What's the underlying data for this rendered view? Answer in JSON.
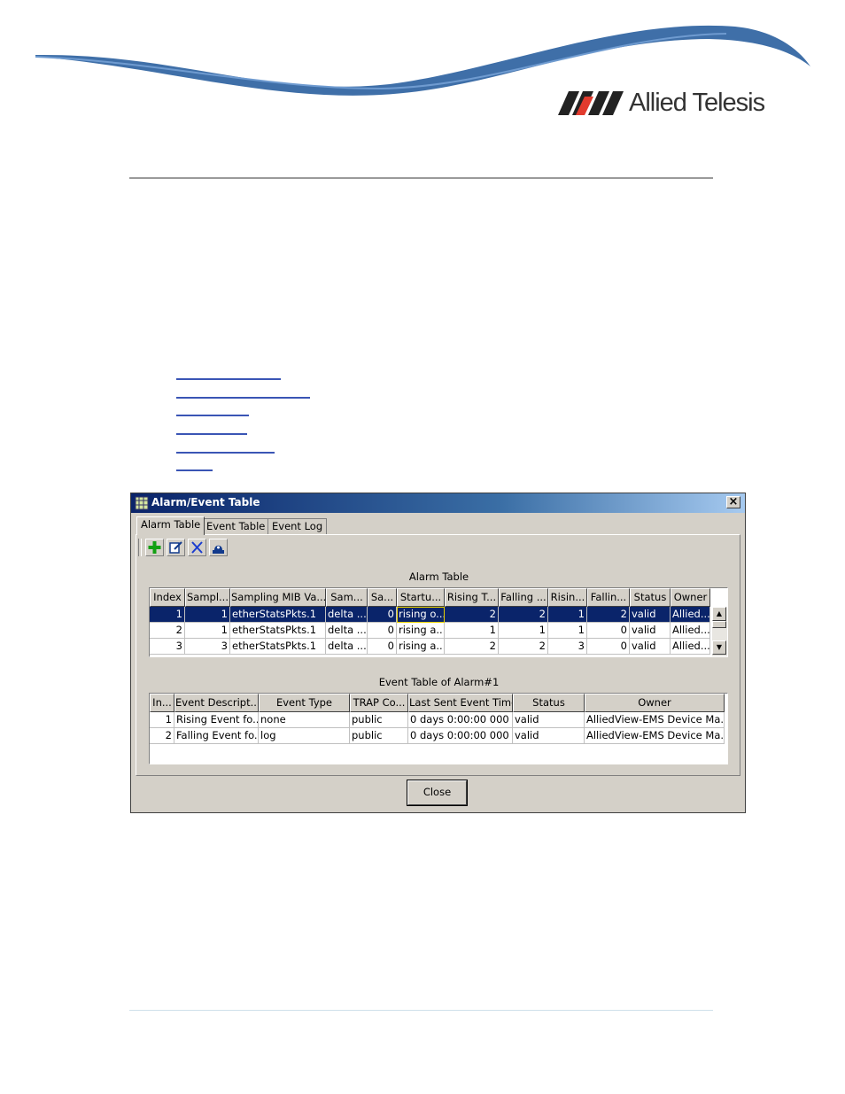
{
  "brand": {
    "name": "Allied Telesis"
  },
  "colors": {
    "link": "#3a55b5",
    "title_bar": "#0a246a",
    "selection": "#0a246a",
    "window_bg": "#d4d0c8"
  },
  "toc_links": 6,
  "dialog": {
    "title": "Alarm/Event Table",
    "tabs": [
      {
        "label": "Alarm Table",
        "active": true
      },
      {
        "label": "Event Table",
        "active": false
      },
      {
        "label": "Event Log",
        "active": false
      }
    ],
    "toolbar": [
      {
        "name": "add-icon"
      },
      {
        "name": "edit-icon"
      },
      {
        "name": "delete-icon"
      },
      {
        "name": "alarm-bell-icon"
      }
    ],
    "alarm_table": {
      "caption": "Alarm Table",
      "headers": [
        "Index",
        "Sampl...",
        "Sampling MIB Va...",
        "Sam...",
        "Sa...",
        "Startu...",
        "Rising T...",
        "Falling ...",
        "Risin...",
        "Fallin...",
        "Status",
        "Owner"
      ],
      "rows": [
        [
          "1",
          "1",
          "etherStatsPkts.1",
          "delta ...",
          "0",
          "rising o...",
          "2",
          "2",
          "1",
          "2",
          "valid",
          "Allied..."
        ],
        [
          "2",
          "1",
          "etherStatsPkts.1",
          "delta ...",
          "0",
          "rising a...",
          "1",
          "1",
          "1",
          "0",
          "valid",
          "Allied..."
        ],
        [
          "3",
          "3",
          "etherStatsPkts.1",
          "delta ...",
          "0",
          "rising a...",
          "2",
          "2",
          "3",
          "0",
          "valid",
          "Allied..."
        ]
      ]
    },
    "event_table": {
      "caption": "Event Table of Alarm#1",
      "headers": [
        "In...",
        "Event Descript...",
        "Event Type",
        "TRAP Co...",
        "Last Sent Event Time",
        "Status",
        "Owner"
      ],
      "rows": [
        [
          "1",
          "Rising Event fo...",
          "none",
          "public",
          "0 days 0:00:00 000",
          "valid",
          "AlliedView-EMS Device Ma..."
        ],
        [
          "2",
          "Falling Event fo...",
          "log",
          "public",
          "0 days 0:00:00 000",
          "valid",
          "AlliedView-EMS Device Ma..."
        ]
      ]
    },
    "close_label": "Close"
  }
}
